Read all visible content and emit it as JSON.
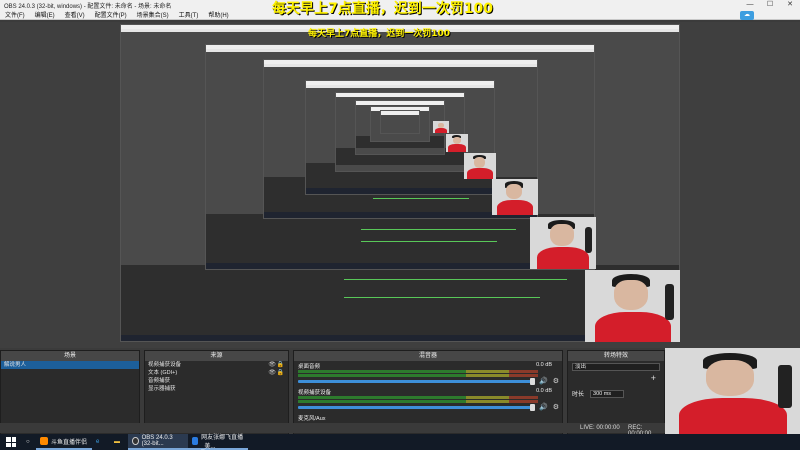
{
  "window": {
    "title": "OBS 24.0.3 (32-bit, windows) - 配置文件: 未命名 - 场景: 未命名",
    "controls": [
      "—",
      "☐",
      "✕"
    ]
  },
  "menu": [
    "文件(F)",
    "编辑(E)",
    "查看(V)",
    "配置文件(P)",
    "场景集合(S)",
    "工具(T)",
    "帮助(H)"
  ],
  "banner": "每天早上7点直播，迟到一次罚100",
  "docks": {
    "scenes": {
      "title": "场景",
      "items": [
        "解说男人"
      ]
    },
    "sources": {
      "title": "来源",
      "items": [
        "视频捕获设备",
        "文本 (GDI+)",
        "音频捕获",
        "显示器捕获"
      ]
    },
    "mixer": {
      "title": "混音器",
      "channels": [
        {
          "name": "桌面音频",
          "db": "0.0 dB"
        },
        {
          "name": "视频捕获设备",
          "db": "0.0 dB"
        },
        {
          "name": "麦克风/Aux",
          "db": ""
        }
      ]
    },
    "transitions": {
      "title": "转场特效",
      "select_label": "淡出",
      "duration_label": "时长",
      "duration_value": "300 ms"
    }
  },
  "status": {
    "live": "LIVE: 00:00:00",
    "rec": "REC: 00:00:00"
  },
  "taskbar": {
    "apps": [
      {
        "label": "斗鱼直播伴侣"
      },
      {
        "label": "OBS 24.0.3 (32-bit..."
      },
      {
        "label": "网友张娜飞直播_美..."
      }
    ]
  },
  "colors": {
    "banner": "#fff200",
    "accent": "#3d8fd9",
    "selected": "#1d5f9a"
  }
}
